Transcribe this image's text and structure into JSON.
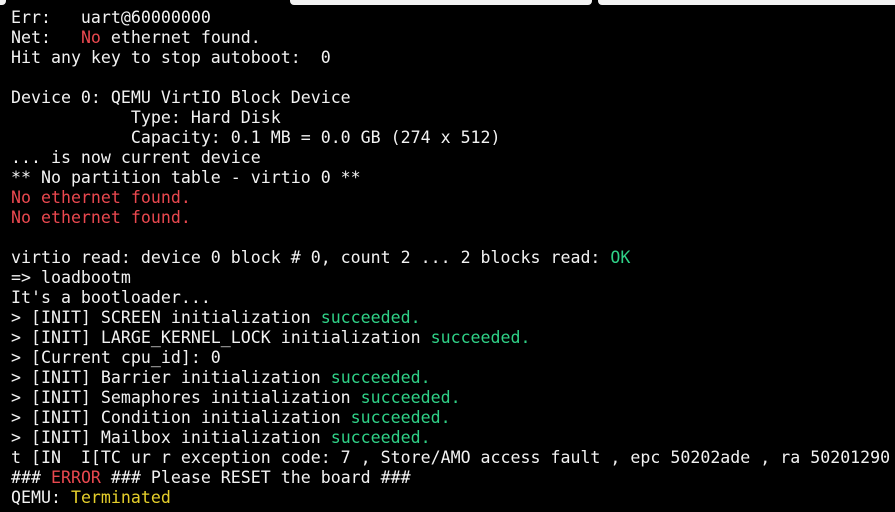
{
  "window": {
    "title": ""
  },
  "colors": {
    "background": "#000000",
    "text": "#f2f2f2",
    "error_red": "#e9484f",
    "success_green": "#2fd187",
    "warning_yellow": "#e5cf2b"
  },
  "terminal": {
    "lines": [
      [
        {
          "t": "Err:   uart@60000000",
          "c": ""
        }
      ],
      [
        {
          "t": "Net:   ",
          "c": ""
        },
        {
          "t": "No",
          "c": "red"
        },
        {
          "t": " ethernet found.",
          "c": ""
        }
      ],
      [
        {
          "t": "Hit any key to stop autoboot:  0",
          "c": ""
        }
      ],
      [
        {
          "t": "",
          "c": ""
        }
      ],
      [
        {
          "t": "Device 0: QEMU VirtIO Block Device",
          "c": ""
        }
      ],
      [
        {
          "t": "            Type: Hard Disk",
          "c": ""
        }
      ],
      [
        {
          "t": "            Capacity: 0.1 MB = 0.0 GB (274 x 512)",
          "c": ""
        }
      ],
      [
        {
          "t": "... is now current device",
          "c": ""
        }
      ],
      [
        {
          "t": "** No partition table - virtio 0 **",
          "c": ""
        }
      ],
      [
        {
          "t": "No ethernet found.",
          "c": "red"
        }
      ],
      [
        {
          "t": "No ethernet found.",
          "c": "red"
        }
      ],
      [
        {
          "t": "",
          "c": ""
        }
      ],
      [
        {
          "t": "virtio read: device 0 block # 0, count 2 ... 2 blocks read: ",
          "c": ""
        },
        {
          "t": "OK",
          "c": "green"
        }
      ],
      [
        {
          "t": "=> loadbootm",
          "c": ""
        }
      ],
      [
        {
          "t": "It's a bootloader...",
          "c": ""
        }
      ],
      [
        {
          "t": "> [INIT] SCREEN initialization ",
          "c": ""
        },
        {
          "t": "succeeded.",
          "c": "green"
        }
      ],
      [
        {
          "t": "> [INIT] LARGE_KERNEL_LOCK initialization ",
          "c": ""
        },
        {
          "t": "succeeded.",
          "c": "green"
        }
      ],
      [
        {
          "t": "> [Current cpu_id]: 0",
          "c": ""
        }
      ],
      [
        {
          "t": "> [INIT] Barrier initialization ",
          "c": ""
        },
        {
          "t": "succeeded.",
          "c": "green"
        }
      ],
      [
        {
          "t": "> [INIT] Semaphores initialization ",
          "c": ""
        },
        {
          "t": "succeeded.",
          "c": "green"
        }
      ],
      [
        {
          "t": "> [INIT] Condition initialization ",
          "c": ""
        },
        {
          "t": "succeeded.",
          "c": "green"
        }
      ],
      [
        {
          "t": "> [INIT] Mailbox initialization ",
          "c": ""
        },
        {
          "t": "succeeded.",
          "c": "green"
        }
      ],
      [
        {
          "t": "t [IN  I[TC ur r exception code: 7 , Store/AMO access fault , epc 50202ade , ra 50201290",
          "c": ""
        }
      ],
      [
        {
          "t": "### ",
          "c": ""
        },
        {
          "t": "ERROR",
          "c": "red"
        },
        {
          "t": " ### Please RESET the board ###",
          "c": ""
        }
      ],
      [
        {
          "t": "QEMU: ",
          "c": ""
        },
        {
          "t": "Terminated",
          "c": "yellow"
        }
      ]
    ]
  }
}
